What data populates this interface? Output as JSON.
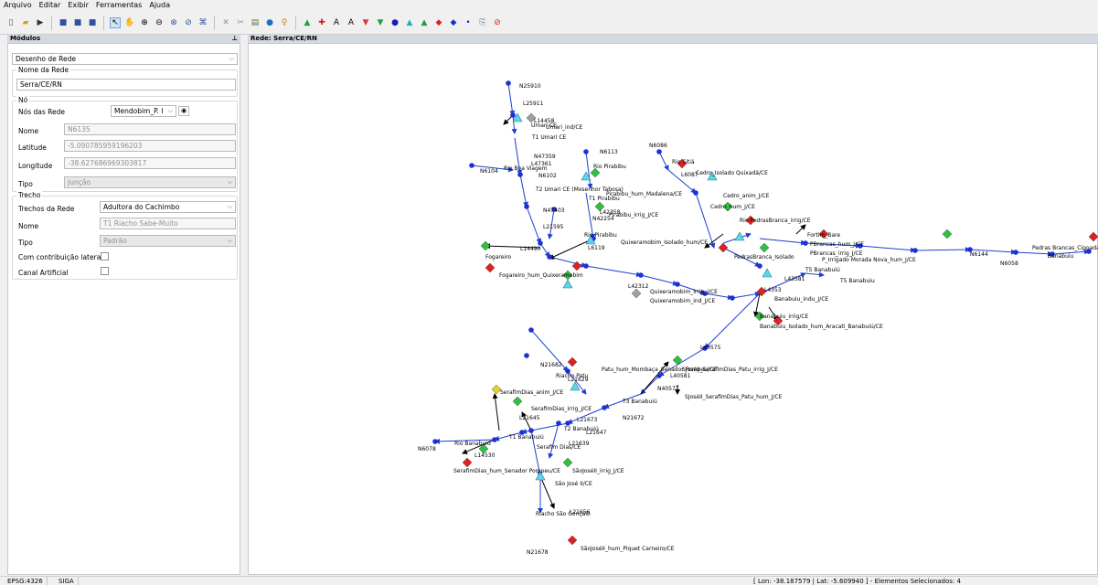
{
  "menu": [
    "Arquivo",
    "Editar",
    "Exibir",
    "Ferramentas",
    "Ajuda"
  ],
  "toolbar_icons": [
    "new-file-icon",
    "open-folder-icon",
    "open-icon",
    "save-icon",
    "save-as-icon",
    "save-all-icon",
    "select-arrow-icon",
    "pan-hand-icon",
    "zoom-in-icon",
    "zoom-out-icon",
    "zoom-window-icon",
    "zoom-extent-icon",
    "zoom-all-icon",
    "delete-icon",
    "cut-icon",
    "paste-icon",
    "globe-icon",
    "weight-icon",
    "node-green-icon",
    "node-red-icon",
    "text-a-icon",
    "text-a2-icon",
    "balloon-icon",
    "balloon2-icon",
    "blue-circle-icon",
    "cyan-triangle-icon",
    "green-triangle-icon",
    "red-diamond-icon",
    "blue-diamond-icon",
    "blue-dot-icon",
    "link-icon",
    "no-entry-icon"
  ],
  "panels": {
    "left_title": "Módulos",
    "right_title": "Rede: Serra/CE/RN"
  },
  "left": {
    "module_select": "Desenho de Rede",
    "network_name_label": "Nome da Rede",
    "network_name": "Serra/CE/RN",
    "node_group": "Nó",
    "nodes_label": "Nós das Rede",
    "nodes_select": "Mendobim_P. I",
    "name_label": "Nome",
    "name_value": "N6135",
    "lat_label": "Latitude",
    "lat_value": "-5.090785959196203",
    "lon_label": "Longitude",
    "lon_value": "-38.627686969303817",
    "type_label": "Tipo",
    "type_value": "Junção",
    "segment_group": "Trecho",
    "segments_label": "Trechos da Rede",
    "segments_select": "Adultora do Cachimbo",
    "seg_name_label": "Nome",
    "seg_name_value": "T1 Riacho Sabe-Muito",
    "seg_type_label": "Tipo",
    "seg_type_value": "Padrão",
    "lateral_label": "Com contribuição lateral",
    "artificial_label": "Canal Artificial"
  },
  "status": {
    "epsg": "EPSG:4326",
    "siga": "SIGA",
    "coords": "[ Lon: -38.187579 | Lat: -5.609940 ] - Elementos Selecionados: 4"
  },
  "map_labels": {
    "N25910": "N25910",
    "L25911": "L25911",
    "L14458": "L14458",
    "Umari_ind": "Umari_ind/CE",
    "Umari": "Umari CE",
    "T1Umari": "T1 Umari CE",
    "N6113": "N6113",
    "N47359": "N47359",
    "L47361": "L47361",
    "N6102": "N6102",
    "RioBoaViagem": "Rio Boa Viagem",
    "N6104": "N6104",
    "T2Umari": "T2 Umari CE (Mosenhor Tabosa)",
    "RioPirabibu": "Rio Pirabibu",
    "N6086": "N6086",
    "RioSitia": "Rio Sitiá",
    "L6087": "L6087",
    "CedroIsolado": "Cedro_Isolado Quixadá/CE",
    "CedroAnim": "Cedro_anim_J/CE",
    "CedroHum": "Cedro_hum_J/CE",
    "Pirabibu_hum": "Pirabibu_hum_Madalena/CE",
    "T1Pirabibu": "T1 Pirabibu",
    "N47403": "N47403",
    "L42358": "L42358",
    "N42254": "N42254",
    "Pirabibu_irrig": "Pirabibu_irrig_J/CE",
    "L21595": "L21595",
    "RioPirabibu2": "Rio Pirabibu",
    "L6119": "L6119",
    "QuixIsolado": "Quixeramobim_Isolado_hum/CE",
    "L14490": "L14490",
    "Fogareiro": "Fogareiro",
    "FogHum": "Fogareiro_hum_Quixeramobim",
    "QuixIrrig": "Quixeramobim_irrig_J/CE",
    "QuixInd": "Quixeramobim_ind_J/CE",
    "L42312": "L42312",
    "RioPedrasBranca": "Rio PedrasBranca_irrig/CE",
    "PedrasBranca": "PedrasBranca_Isolado",
    "FortimBare": "Fortim_Bare",
    "PedrasHum": "PBrancas_hum_J/CE",
    "PedrasIrrig": "PBrancas_irrig_J/CE",
    "PedrasIrrigado": "P_Irrigado Morada Nova_hum_J/CE",
    "T5Banabuiu": "T5 Banabuiú",
    "L43581": "L43581",
    "L4353": "L4353",
    "Banabuiu_indu": "Banabuiu_indu_J/CE",
    "Banabuiu_irrig": "Banabuiu_irrig/CE",
    "BanabuiuIsolado": "Banabuiu_Isolado_hum_Aracati_Banabuiú/CE",
    "L40575": "L40575",
    "PatuHum": "Patu_hum_Mombaça_Senador Pompeu/CE",
    "RiachoPatu": "Riacho Patu",
    "N21682": "N21682",
    "L21629": "L21629",
    "SJoseIrrig": "SJoséII_SerafimDias_Patu_irrig_J/CE",
    "SJoseHum": "SJoséII_SerafimDias_Patu_hum_J/CE",
    "T3Banabuiu": "T3 Banabuiú",
    "L40581": "L40581",
    "N40577": "N40577",
    "SerafimAnim": "SerafimDias_anim_J/CE",
    "SerafimIrrig": "SerafimDias_irrig_J/CE",
    "L21645": "L21645",
    "L21673": "L21673",
    "N21672": "N21672",
    "T2Banabuiu": "T2 Banabuiú",
    "L21647": "L21647",
    "T1Banabuiu": "T1 Banabuiú",
    "SerafimDias": "Serafim Dias/CE",
    "L21639": "L21639",
    "RioBanabuiu": "Rio Banabuiú",
    "N6078": "N6078",
    "L14530": "L14530",
    "SerafimDiasHum": "SerafimDias_hum_Senador Pompeu/CE",
    "SJoseIrrig2": "SãoJoséII_irrig_J/CE",
    "SaoJose": "São José II/CE",
    "L21656": "L21656",
    "RiachoSao": "Riacho São Gonçalo",
    "N21678": "N21678",
    "SJoseHum2": "SãoJoséII_hum_Piquet Carneiro/CE",
    "Banabuiu": "Banabuiu",
    "N6058": "N6058",
    "N6144": "N6144",
    "PedrasJoatama": "Pedras Brancas_Cipoada_PoçoDoBarro_irrig",
    "T5Banabuiu2": "T5 Banabuiu"
  }
}
